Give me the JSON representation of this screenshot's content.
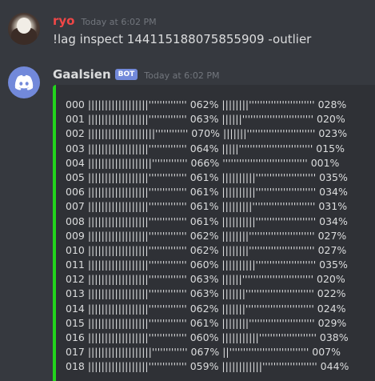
{
  "messages": [
    {
      "author": "ryo",
      "author_color": "#f04747",
      "timestamp": "Today at 6:02 PM",
      "text": "!lag inspect 144115188075855909 -outlier"
    },
    {
      "author": "Gaalsien",
      "author_color": "#dcddde",
      "bot_tag": "BOT",
      "timestamp": "Today at 6:02 PM"
    }
  ],
  "embed": {
    "accent_color": "#22d51c",
    "rows": [
      "000 ||||||||||||||||||'''''''''''''' 062% ||||||||'''''''''''''''''''''''' 028%",
      "001 ||||||||||||||||||'''''''''''''' 063% ||||||'''''''''''''''''''''''''' 020%",
      "002 ||||||||||||||||||||'''''''''''' 070% |||||||''''''''''''''''''''''''' 023%",
      "003 ||||||||||||||||||'''''''''''''' 064% |||||''''''''''''''''''''''''''' 015%",
      "004 |||||||||||||||||||''''''''''''' 066% ''''''''''''''''''''''''''''''' 001%",
      "005 ||||||||||||||||||'''''''''''''' 061% ||||||||||'''''''''''''''''''''' 035%",
      "006 ||||||||||||||||||'''''''''''''' 061% ||||||||||'''''''''''''''''''''' 034%",
      "007 ||||||||||||||||||'''''''''''''' 061% |||||||||''''''''''''''''''''''' 031%",
      "008 ||||||||||||||||||'''''''''''''' 061% ||||||||||'''''''''''''''''''''' 034%",
      "009 ||||||||||||||||||'''''''''''''' 062% ||||||||'''''''''''''''''''''''' 027%",
      "010 ||||||||||||||||||'''''''''''''' 062% ||||||||'''''''''''''''''''''''' 027%",
      "011 ||||||||||||||||||'''''''''''''' 060% ||||||||||'''''''''''''''''''''' 035%",
      "012 ||||||||||||||||||'''''''''''''' 063% ||||||'''''''''''''''''''''''''' 020%",
      "013 ||||||||||||||||||'''''''''''''' 063% |||||||''''''''''''''''''''''''' 022%",
      "014 ||||||||||||||||||'''''''''''''' 062% |||||||''''''''''''''''''''''''' 024%",
      "015 ||||||||||||||||||'''''''''''''' 061% ||||||||'''''''''''''''''''''''' 029%",
      "016 ||||||||||||||||||'''''''''''''' 060% |||||||||||''''''''''''''''''''' 038%",
      "017 |||||||||||||||||||''''''''''''' 067% ||''''''''''''''''''''''''''''' 007%",
      "018 ||||||||||||||||||'''''''''''''' 059% ||||||||||||'''''''''''''''''''' 044%"
    ]
  },
  "icons": {
    "bot_avatar": "discord-logo-icon",
    "user_avatar": "user-avatar-photo"
  }
}
